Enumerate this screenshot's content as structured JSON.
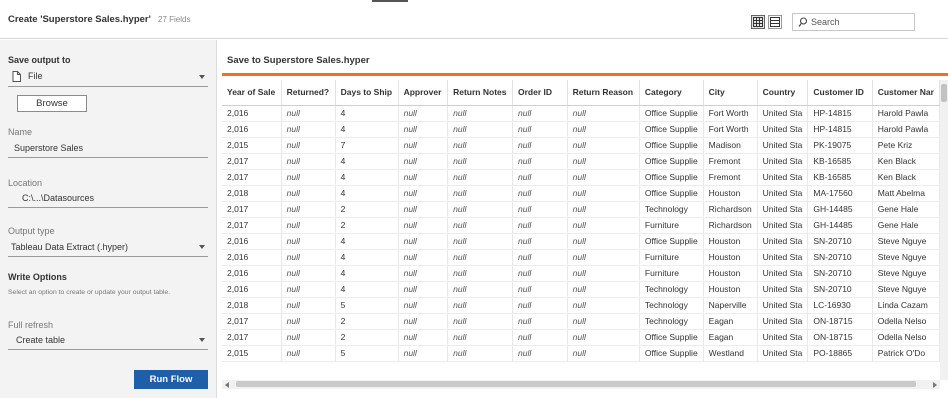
{
  "header": {
    "title": "Create 'Superstore Sales.hyper'",
    "field_count": "27 Fields",
    "search_placeholder": "Search",
    "icons": [
      "table-view-icon",
      "list-view-icon",
      "search-icon"
    ]
  },
  "left_panel": {
    "save_output_label": "Save output to",
    "save_output_value": "File",
    "browse_label": "Browse",
    "name_label": "Name",
    "name_value": "Superstore Sales",
    "location_label": "Location",
    "location_value": "C:\\...\\Datasources",
    "output_type_label": "Output type",
    "output_type_value": "Tableau Data Extract (.hyper)",
    "write_options_label": "Write Options",
    "write_options_hint": "Select an option to create or update your output table.",
    "refresh_label": "Full refresh",
    "refresh_value": "Create table",
    "run_label": "Run Flow"
  },
  "preview": {
    "title": "Save to Superstore Sales.hyper",
    "accent_color": "#f26e22",
    "columns": [
      "Year of Sale",
      "Returned?",
      "Days to Ship",
      "Approver",
      "Return Notes",
      "Order ID",
      "Return Reason",
      "Category",
      "City",
      "Country",
      "Customer ID",
      "Customer Nar"
    ],
    "rows": [
      [
        "2,016",
        "null",
        "4",
        "null",
        "null",
        "null",
        "null",
        "Office Supplie",
        "Fort Worth",
        "United Sta",
        "HP-14815",
        "Harold Pawla"
      ],
      [
        "2,016",
        "null",
        "4",
        "null",
        "null",
        "null",
        "null",
        "Office Supplie",
        "Fort Worth",
        "United Sta",
        "HP-14815",
        "Harold Pawla"
      ],
      [
        "2,015",
        "null",
        "7",
        "null",
        "null",
        "null",
        "null",
        "Office Supplie",
        "Madison",
        "United Sta",
        "PK-19075",
        "Pete Kriz"
      ],
      [
        "2,017",
        "null",
        "4",
        "null",
        "null",
        "null",
        "null",
        "Office Supplie",
        "Fremont",
        "United Sta",
        "KB-16585",
        "Ken Black"
      ],
      [
        "2,017",
        "null",
        "4",
        "null",
        "null",
        "null",
        "null",
        "Office Supplie",
        "Fremont",
        "United Sta",
        "KB-16585",
        "Ken Black"
      ],
      [
        "2,018",
        "null",
        "4",
        "null",
        "null",
        "null",
        "null",
        "Office Supplie",
        "Houston",
        "United Sta",
        "MA-17560",
        "Matt Abelma"
      ],
      [
        "2,017",
        "null",
        "2",
        "null",
        "null",
        "null",
        "null",
        "Technology",
        "Richardson",
        "United Sta",
        "GH-14485",
        "Gene Hale"
      ],
      [
        "2,017",
        "null",
        "2",
        "null",
        "null",
        "null",
        "null",
        "Furniture",
        "Richardson",
        "United Sta",
        "GH-14485",
        "Gene Hale"
      ],
      [
        "2,016",
        "null",
        "4",
        "null",
        "null",
        "null",
        "null",
        "Office Supplie",
        "Houston",
        "United Sta",
        "SN-20710",
        "Steve Nguye"
      ],
      [
        "2,016",
        "null",
        "4",
        "null",
        "null",
        "null",
        "null",
        "Furniture",
        "Houston",
        "United Sta",
        "SN-20710",
        "Steve Nguye"
      ],
      [
        "2,016",
        "null",
        "4",
        "null",
        "null",
        "null",
        "null",
        "Furniture",
        "Houston",
        "United Sta",
        "SN-20710",
        "Steve Nguye"
      ],
      [
        "2,016",
        "null",
        "4",
        "null",
        "null",
        "null",
        "null",
        "Technology",
        "Houston",
        "United Sta",
        "SN-20710",
        "Steve Nguye"
      ],
      [
        "2,018",
        "null",
        "5",
        "null",
        "null",
        "null",
        "null",
        "Technology",
        "Naperville",
        "United Sta",
        "LC-16930",
        "Linda Cazam"
      ],
      [
        "2,017",
        "null",
        "2",
        "null",
        "null",
        "null",
        "null",
        "Technology",
        "Eagan",
        "United Sta",
        "ON-18715",
        "Odella Nelso"
      ],
      [
        "2,017",
        "null",
        "2",
        "null",
        "null",
        "null",
        "null",
        "Office Supplie",
        "Eagan",
        "United Sta",
        "ON-18715",
        "Odella Nelso"
      ],
      [
        "2,015",
        "null",
        "5",
        "null",
        "null",
        "null",
        "null",
        "Office Supplie",
        "Westland",
        "United Sta",
        "PO-18865",
        "Patrick O'Do"
      ]
    ]
  }
}
